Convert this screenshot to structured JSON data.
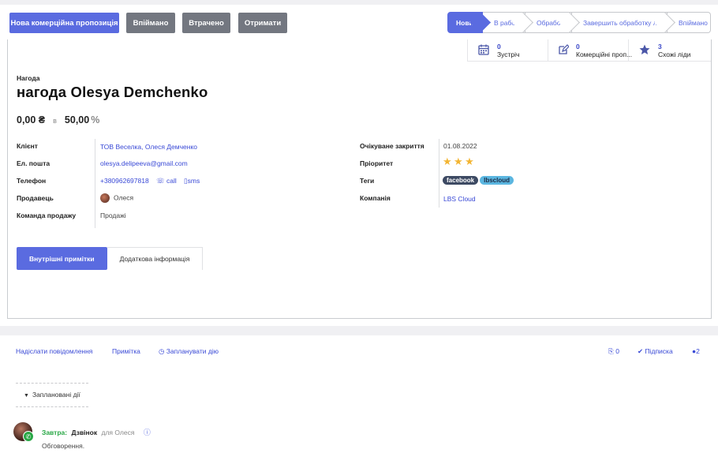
{
  "control": {
    "buttons": {
      "new_quote": "Нова комерційна пропозиція",
      "won": "Впіймано",
      "lost": "Втрачено",
      "receive": "Отримати"
    },
    "stages": [
      "Новий",
      "В работе",
      "Обработан",
      "Завершить обработку лида",
      "Впіймано"
    ],
    "active_stage": "Новий"
  },
  "smart_buttons": [
    {
      "icon": "calendar-icon",
      "value": "0",
      "label": "Зустріч"
    },
    {
      "icon": "edit-icon",
      "value": "0",
      "label": "Комерційні проп..."
    },
    {
      "icon": "star-icon",
      "value": "3",
      "label": "Схожі ліди"
    }
  ],
  "opportunity": {
    "kind_label": "Нагода",
    "title": "нагода Olesya Demchenko",
    "revenue": "0,00 ₴",
    "in_label": "в",
    "probability": "50,00",
    "percent_sign": "%"
  },
  "fields_left": {
    "client_label": "Клієнт",
    "client_value": "ТОВ Веселка, Олеся Демченко",
    "email_label": "Ел. пошта",
    "email_value": "olesya.delipeeva@gmail.com",
    "phone_label": "Телефон",
    "phone_value": "+380962697818",
    "call_label": "☏ call",
    "sms_label": "▯sms",
    "salesperson_label": "Продавець",
    "salesperson_value": "Олеся",
    "team_label": "Команда продажу",
    "team_value": "Продажі"
  },
  "fields_right": {
    "close_label": "Очікуване закриття",
    "close_value": "01.08.2022",
    "priority_label": "Пріоритет",
    "priority_stars": 3,
    "tags_label": "Теги",
    "tags": [
      {
        "name": "facebook",
        "color": "#3d4a63"
      },
      {
        "name": "lbscloud",
        "color": "#5bb6e0"
      }
    ],
    "company_label": "Компанія",
    "company_value": "LBS Cloud"
  },
  "tabs": [
    "Внутрішні примітки",
    "Додаткова інформація"
  ],
  "chatter": {
    "send_message": "Надіслати повідомлення",
    "log_note": "Примітка",
    "schedule": "◷ Запланувати дію",
    "attachments": "0",
    "follow": "✔ Підписка",
    "followers": "2",
    "planned": "Заплановані дії",
    "activity": {
      "when": "Завтра:",
      "type": "Дзвінок",
      "for": "для Олеся",
      "note": "Обговорення."
    }
  },
  "colors": {
    "primary": "#5a6be0",
    "secondary": "#737780",
    "link": "#3949d6",
    "star": "#f3b532",
    "success": "#28a745"
  }
}
